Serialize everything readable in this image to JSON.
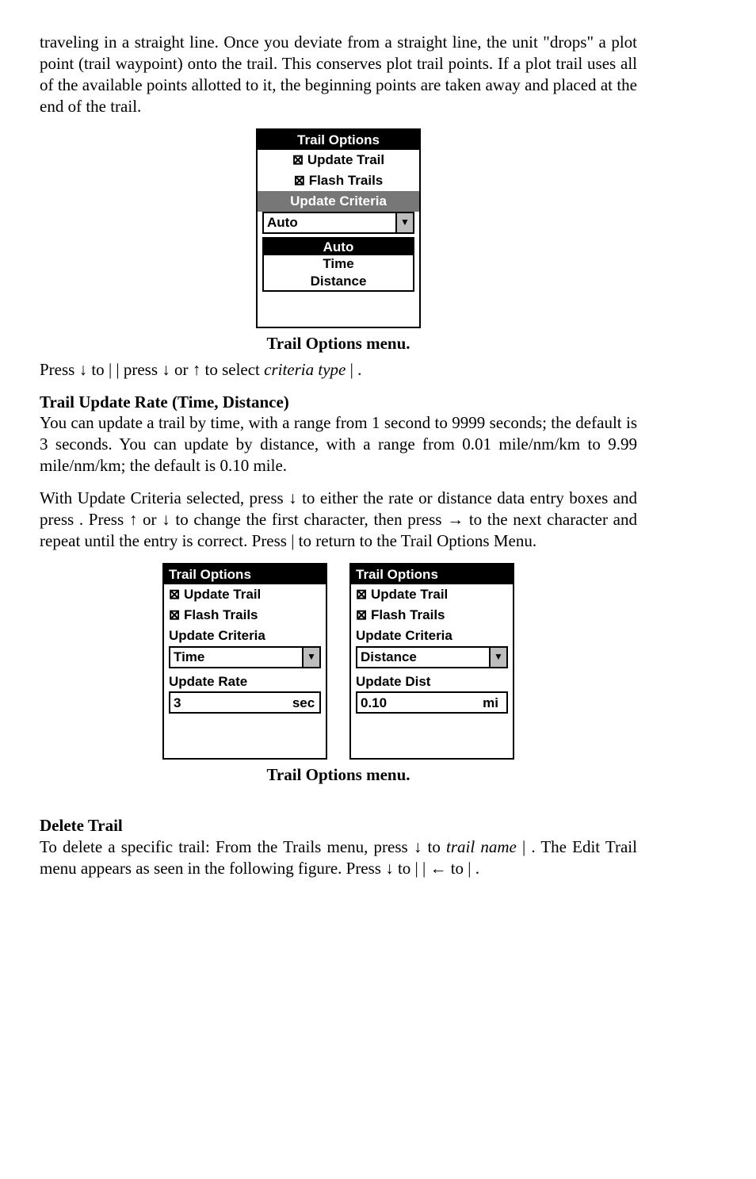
{
  "para1": "traveling in a straight line. Once you deviate from a straight line, the unit \"drops\" a plot point (trail waypoint) onto the trail. This conserves plot trail points. If a plot trail uses all of the available points allotted to it, the beginning points are taken away and placed at the end of the trail.",
  "mock1": {
    "title": "Trail Options",
    "item1": "Update Trail",
    "item2": "Flash Trails",
    "subtitle": "Update Criteria",
    "combo_value": "Auto",
    "opts": [
      "Auto",
      "Time",
      "Distance"
    ]
  },
  "caption1": "Trail Options menu.",
  "line1a": "Press ↓ to ",
  "line1b": "|    | press ↓ or ↑ to select ",
  "line1c": "criteria type",
  "line1d": " |      .",
  "heading1": "Trail Update Rate (Time, Distance)",
  "para2": "You can update a trail by time, with a range from 1 second to 9999 seconds; the default is 3 seconds. You can update by distance, with a range from 0.01 mile/nm/km to 9.99 mile/nm/km; the default is 0.10 mile.",
  "para3a": "With Update Criteria selected, press ↓ to either the rate or distance data entry boxes and press       . Press ↑ or ↓ to change the first character, then press → to the next character and repeat until the entry is correct. Press       |        to return to the Trail Options Menu.",
  "mock2": {
    "title": "Trail Options",
    "item1": "Update Trail",
    "item2": "Flash Trails",
    "criteria_label": "Update Criteria",
    "criteria_value": "Time",
    "field_label": "Update Rate",
    "field_value": "3",
    "field_unit": "sec"
  },
  "mock3": {
    "title": "Trail Options",
    "item1": "Update Trail",
    "item2": "Flash Trails",
    "criteria_label": "Update Criteria",
    "criteria_value": "Distance",
    "field_label": "Update Dist",
    "field_value": "0.10",
    "field_unit": "mi"
  },
  "caption2": "Trail Options menu.",
  "heading2": "Delete Trail",
  "para4a": "To delete a specific trail: From the Trails menu, press ↓ to ",
  "para4b": "trail name",
  "para4c": " |      . The Edit Trail menu appears as seen in the following figure. Press ↓ to                     |       | ← to       |      ."
}
